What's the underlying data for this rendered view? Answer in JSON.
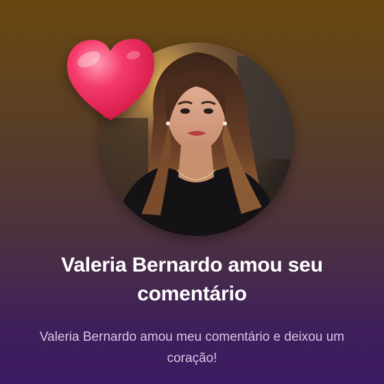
{
  "notification": {
    "title": "Valeria Bernardo amou seu comentário",
    "message": "Valeria Bernardo amou meu comentário e deixou um coração!"
  },
  "avatar": {
    "icon": "profile-photo"
  },
  "reaction": {
    "icon": "heart-icon",
    "color": "#f0285e"
  },
  "colors": {
    "background_top": "#6a4710",
    "background_bottom": "#3a1a60",
    "title_text": "#ffffff",
    "message_text": "#d6c7e2"
  }
}
